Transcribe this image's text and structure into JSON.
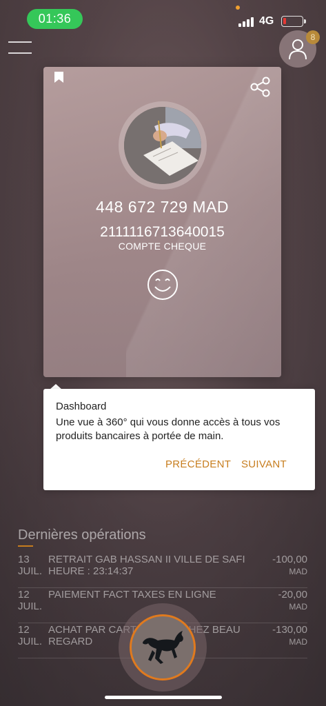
{
  "status_bar": {
    "time": "01:36",
    "network": "4G",
    "battery_level": 0.15,
    "battery_color": "#e53935",
    "time_pill_color": "#35c759"
  },
  "header": {
    "menu_icon": "hamburger-menu-icon",
    "profile_icon": "user-icon",
    "notification_count": "8"
  },
  "account_card": {
    "balance": "448 672 729 MAD",
    "account_number": "211111671364001​5",
    "account_type": "COMPTE CHEQUE",
    "icons": [
      "bookmark-icon",
      "share-icon",
      "smiley-icon"
    ]
  },
  "tooltip": {
    "title": "Dashboard",
    "text": "Une vue à 360° qui vous donne accès à tous vos produits bancaires à portée de main.",
    "previous_label": "PRÉCÉDENT",
    "next_label": "SUIVANT",
    "accent_color": "#c77d1e"
  },
  "operations": {
    "title": "Dernières opérations",
    "items": [
      {
        "day": "13",
        "month": "JUIL.",
        "description": "RETRAIT GAB HASSAN II VILLE DE SAFI HEURE : 23:14:37",
        "amount": "-100,00",
        "currency": "MAD"
      },
      {
        "day": "12",
        "month": "JUIL.",
        "description": "PAIEMENT FACT TAXES EN LIGNE",
        "amount": "-20,00",
        "currency": "MAD"
      },
      {
        "day": "12",
        "month": "JUIL.",
        "description": "ACHAT PAR CARTE ... ENT CHEZ BEAU REGARD",
        "amount": "-130,00",
        "currency": "MAD"
      }
    ]
  },
  "fab": {
    "icon": "horse-logo-icon",
    "ring_color": "#e07a1e"
  }
}
